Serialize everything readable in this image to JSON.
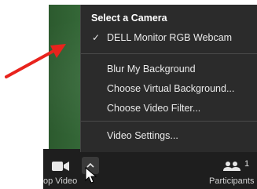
{
  "menu": {
    "header": "Select a Camera",
    "camera_item": {
      "label": "DELL Monitor RGB Webcam",
      "checkmark": "✓",
      "selected": true
    },
    "background_items": [
      {
        "label": "Blur My Background"
      },
      {
        "label": "Choose Virtual Background..."
      },
      {
        "label": "Choose Video Filter..."
      }
    ],
    "settings_item": {
      "label": "Video Settings..."
    }
  },
  "toolbar": {
    "video_label": "op Video",
    "participants_count": "1",
    "participants_label": "Participants"
  },
  "icons": {
    "video": "video-camera-icon",
    "caret": "chevron-up-icon",
    "participants": "participants-icon",
    "annotation": "red-arrow-icon",
    "cursor": "mouse-pointer-icon"
  },
  "colors": {
    "menu_background": "#2b2b2b",
    "toolbar_background": "#1e1e1e",
    "annotation_arrow": "#e8231d",
    "camera_background": "#3f7843"
  }
}
